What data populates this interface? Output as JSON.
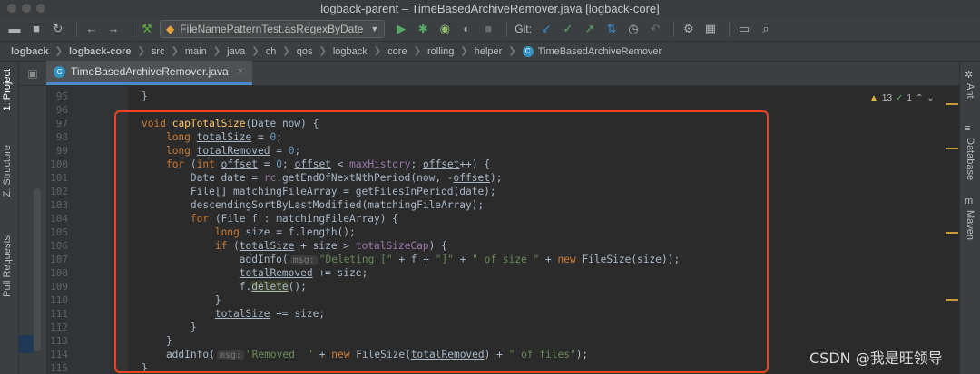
{
  "window": {
    "title": "logback-parent – TimeBasedArchiveRemover.java [logback-core]"
  },
  "toolbar": {
    "run_config": "FileNamePatternTest.asRegexByDate",
    "git_label": "Git:"
  },
  "breadcrumb": [
    "logback",
    "logback-core",
    "src",
    "main",
    "java",
    "ch",
    "qos",
    "logback",
    "core",
    "rolling",
    "helper",
    "TimeBasedArchiveRemover"
  ],
  "left_tabs": [
    "1: Project",
    "Z: Structure",
    "Pull Requests"
  ],
  "right_tabs": [
    "Ant",
    "Database",
    "Maven"
  ],
  "editor": {
    "tab_label": "TimeBasedArchiveRemover.java",
    "inspection": {
      "warnings": "13",
      "ok": "1"
    },
    "line_numbers": [
      "95",
      "96",
      "97",
      "98",
      "99",
      "100",
      "101",
      "102",
      "103",
      "104",
      "105",
      "106",
      "107",
      "108",
      "109",
      "110",
      "111",
      "112",
      "113",
      "114",
      "115"
    ],
    "hint_msg": "msg:"
  },
  "watermark": "CSDN @我是旺领导",
  "colors": {
    "keyword": "#cc7832",
    "method": "#ffc66d",
    "number": "#6897bb",
    "string": "#6a8759",
    "field": "#9876aa",
    "highlight": "#e8461e"
  }
}
